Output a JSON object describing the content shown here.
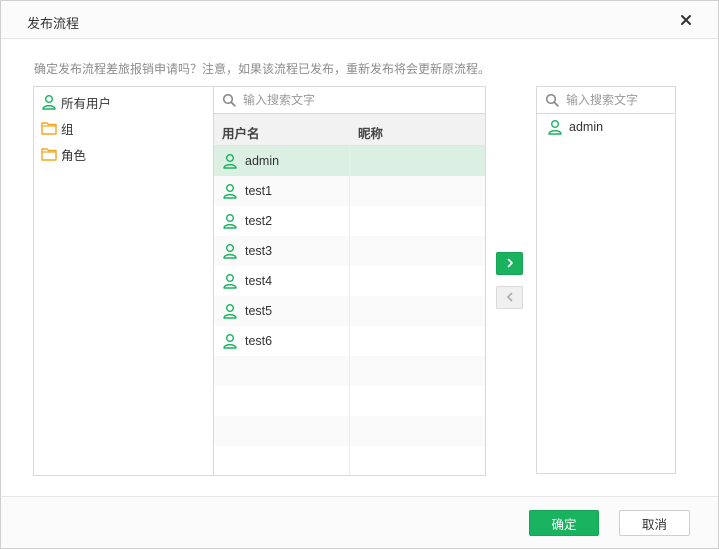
{
  "dialog": {
    "title": "发布流程",
    "message": "确定发布流程差旅报销申请吗？注意，如果该流程已发布，重新发布将会更新原流程。"
  },
  "tree": {
    "items": [
      {
        "label": "所有用户",
        "icon": "user-icon"
      },
      {
        "label": "组",
        "icon": "folder-icon"
      },
      {
        "label": "角色",
        "icon": "folder-icon"
      }
    ]
  },
  "center": {
    "search_placeholder": "输入搜索文字",
    "columns": [
      "用户名",
      "昵称"
    ],
    "rows": [
      {
        "username": "admin",
        "nickname": "",
        "selected": true
      },
      {
        "username": "test1",
        "nickname": ""
      },
      {
        "username": "test2",
        "nickname": ""
      },
      {
        "username": "test3",
        "nickname": ""
      },
      {
        "username": "test4",
        "nickname": ""
      },
      {
        "username": "test5",
        "nickname": ""
      },
      {
        "username": "test6",
        "nickname": ""
      }
    ]
  },
  "right": {
    "search_placeholder": "输入搜索文字",
    "items": [
      {
        "label": "admin",
        "icon": "user-icon"
      }
    ]
  },
  "footer": {
    "ok_label": "确定",
    "cancel_label": "取消"
  },
  "colors": {
    "accent": "#19b35f",
    "selected_row": "#dcefe3",
    "folder": "#f5a623"
  }
}
